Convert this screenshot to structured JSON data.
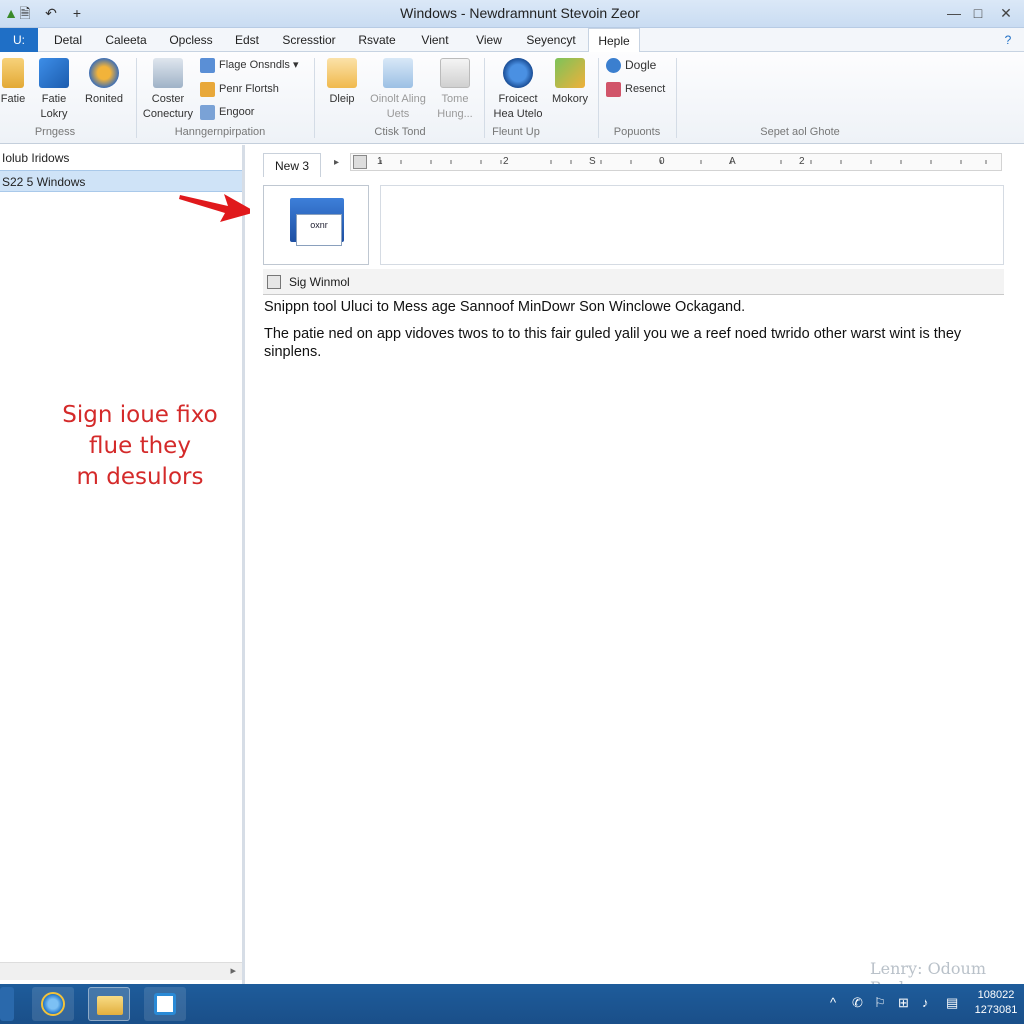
{
  "window": {
    "title": "Windows - Newdramnunt Stevoin Zeor",
    "controls": {
      "minimize": "—",
      "maximize": "□",
      "close": "✕"
    },
    "quick_access": [
      "save-icon",
      "undo-icon",
      "new-icon"
    ]
  },
  "tabs": [
    {
      "label": "U:",
      "kind": "file"
    },
    {
      "label": "Detal"
    },
    {
      "label": "Caleeta"
    },
    {
      "label": "Opcless"
    },
    {
      "label": "Edst"
    },
    {
      "label": "Scresstior"
    },
    {
      "label": "Rsvate"
    },
    {
      "label": "Vient"
    },
    {
      "label": "View"
    },
    {
      "label": "Seyencyt"
    },
    {
      "label": "Heple",
      "active": true
    }
  ],
  "ribbon": {
    "groups": [
      {
        "label": "Prngess",
        "items": [
          "Fatie",
          "Fatie Lokry",
          "Ronited"
        ]
      },
      {
        "label": "Hanngernpirpation",
        "items": [
          "Coster Conectury",
          "Flage Onsndls",
          "Penr Flortsh",
          "Engoor"
        ]
      },
      {
        "label": "Ctisk Tond",
        "items": [
          "Dleip",
          "Oinolt Aling Uets",
          "Tome Hung..."
        ]
      },
      {
        "label": "Fleunt Up",
        "items": [
          "Froicect Hea Utelo",
          "Mokory"
        ]
      },
      {
        "label": "Popuonts",
        "items": [
          "Dogle",
          "Resenct"
        ]
      },
      {
        "label": "Sepet aol Ghote",
        "items": []
      }
    ]
  },
  "sidebar": {
    "items": [
      {
        "label": "Iolub Iridows"
      },
      {
        "label": "S22 5 Windows",
        "selected": true
      }
    ],
    "annotation": [
      "Sign ioue fixo",
      "flue they",
      "m desulors"
    ]
  },
  "document": {
    "tab_label": "New 3",
    "ruler_marks": [
      "1",
      "2",
      "S",
      "0",
      "A",
      "2"
    ],
    "thumb_text": "oxnr",
    "caption": "Sig Winmol",
    "heading": "Snippn tool Uluci to Mess age Sannoof MinDowr Son Winclowe Ockagand.",
    "paragraph": "The patie ned on app vidoves twos to to this fair guled yalil you we a reef noed twrido other warst wint is they sinplens.",
    "watermark": "Lenry: Odoum Bsche"
  },
  "taskbar": {
    "apps": [
      "ie-icon",
      "explorer-icon",
      "store-icon"
    ],
    "tray": [
      "^",
      "✆",
      "⚐",
      "⊞",
      "♪",
      "▤"
    ],
    "clock_time": "108022",
    "clock_date": "1273081"
  },
  "colors": {
    "file_tab": "#1f6fc6",
    "selection": "#cfe3f7",
    "annotation": "#d42a2a",
    "taskbar": "#1e5c9b"
  }
}
